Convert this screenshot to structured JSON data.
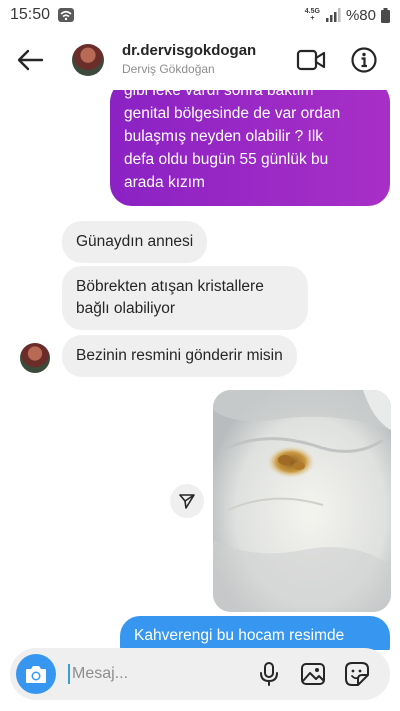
{
  "status_bar": {
    "time": "15:50",
    "network_top": "4.5G",
    "network_bottom": "+",
    "battery": "%80"
  },
  "header": {
    "username": "dr.dervisgokdogan",
    "display_name": "Derviş Gökdoğan",
    "icons": [
      "back-arrow-icon",
      "video-call-icon",
      "info-icon"
    ]
  },
  "messages": {
    "sent_1": {
      "lines": [
        "gibi leke vardı sonra baktım",
        "genital bölgesinde de var ordan",
        "bulaşmış neyden olabilir ? Ilk",
        "defa oldu bugün 55 günlük bu",
        "arada kızım"
      ]
    },
    "received_1": "Günaydın annesi",
    "received_2": "Böbrekten atışan kristallere bağlı olabiliyor",
    "received_3": "Bezinin resmini gönderir misin",
    "sent_2": "Kahverengi bu hocam resimde"
  },
  "composer": {
    "placeholder": "Mesaj...",
    "icons": [
      "camera-icon",
      "microphone-icon",
      "gallery-icon",
      "sticker-icon"
    ]
  },
  "colors": {
    "sent_gradient_start": "#8b22c4",
    "sent_gradient_end": "#a82fc6",
    "sent_blue": "#3797f0",
    "received_bg": "#efefef"
  }
}
